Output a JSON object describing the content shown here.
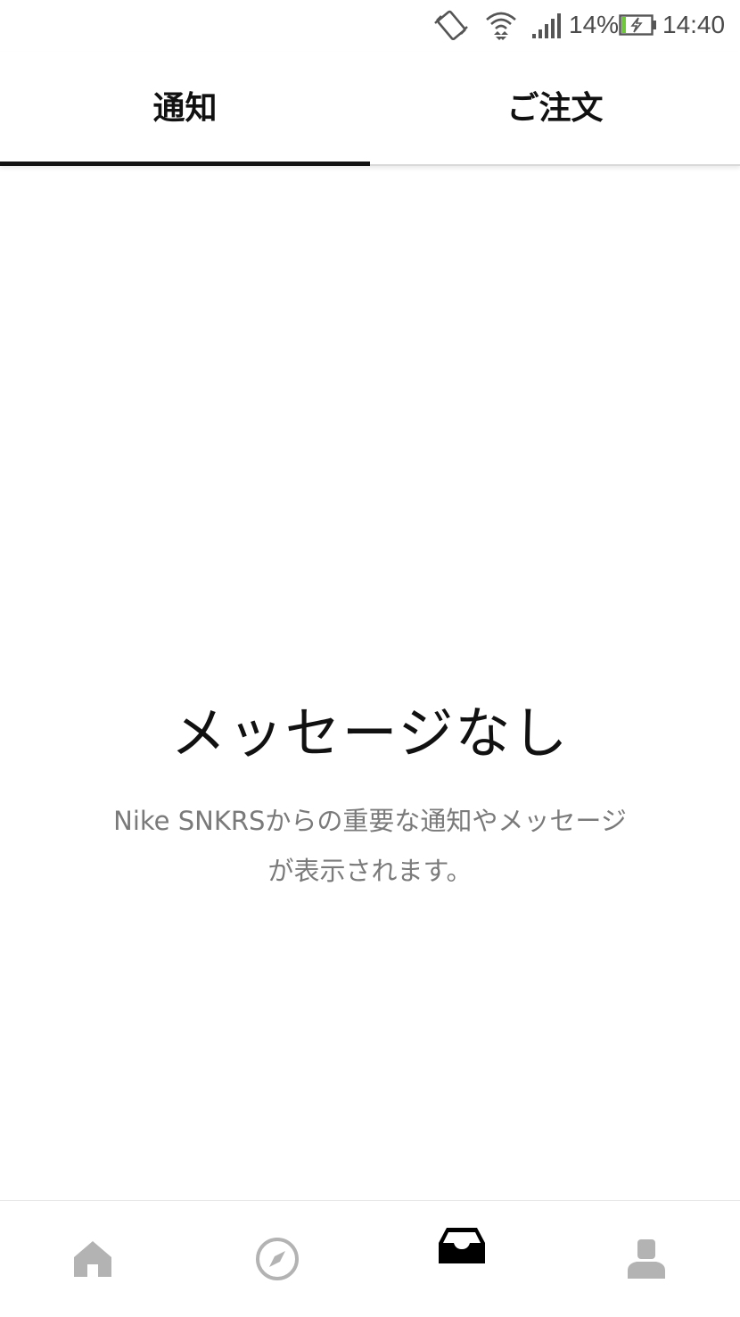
{
  "status_bar": {
    "battery_percent": "14%",
    "time": "14:40",
    "icons": [
      "vibrate-icon",
      "wifi-icon",
      "signal-icon",
      "battery-charging-icon"
    ],
    "battery_level": 0.14,
    "battery_color": "#6fc93b"
  },
  "tabs": [
    {
      "label": "通知",
      "active": true
    },
    {
      "label": "ご注文",
      "active": false
    }
  ],
  "empty_state": {
    "title": "メッセージなし",
    "description": "Nike SNKRSからの重要な通知やメッセージが表示されます。"
  },
  "bottom_nav": {
    "items": [
      {
        "icon": "home-icon",
        "active": false
      },
      {
        "icon": "compass-icon",
        "active": false
      },
      {
        "icon": "inbox-icon",
        "active": true
      },
      {
        "icon": "profile-icon",
        "active": false
      }
    ],
    "active_color": "#000000",
    "inactive_color": "#b3b3b3"
  }
}
